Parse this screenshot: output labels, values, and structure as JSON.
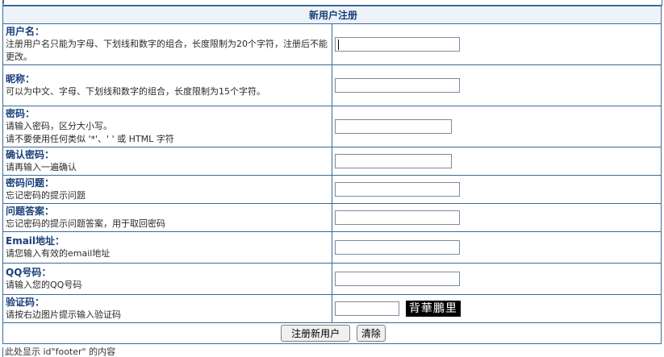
{
  "form": {
    "title": "新用户注册",
    "fields": [
      {
        "label": "用户名：",
        "hint": "注册用户名只能为字母、下划线和数字的组合，长度限制为20个字符，注册后不能更改。",
        "value": ""
      },
      {
        "label": "昵称：",
        "hint": "可以为中文、字母、下划线和数字的组合，长度限制为15个字符。",
        "value": ""
      },
      {
        "label": "密码：",
        "hint": "请输入密码，区分大小写。",
        "hint2": "请不要使用任何类似 '*'、' ' 或 HTML 字符",
        "value": ""
      },
      {
        "label": "确认密码：",
        "hint": "请再输入一遍确认",
        "value": ""
      },
      {
        "label": "密码问题：",
        "hint": "忘记密码的提示问题",
        "value": ""
      },
      {
        "label": "问题答案：",
        "hint": "忘记密码的提示问题答案，用于取回密码",
        "value": ""
      },
      {
        "label": "Email地址：",
        "hint": "请您输入有效的email地址",
        "value": ""
      },
      {
        "label": "QQ号码：",
        "hint": "请输入您的QQ号码",
        "value": ""
      },
      {
        "label": "验证码：",
        "hint": "请按右边图片提示输入验证码",
        "value": ""
      }
    ],
    "captcha_text": "背華鵬里",
    "submit_label": "注册新用户",
    "reset_label": "清除"
  },
  "footer_note": "此处显示 id\"footer\" 的内容"
}
